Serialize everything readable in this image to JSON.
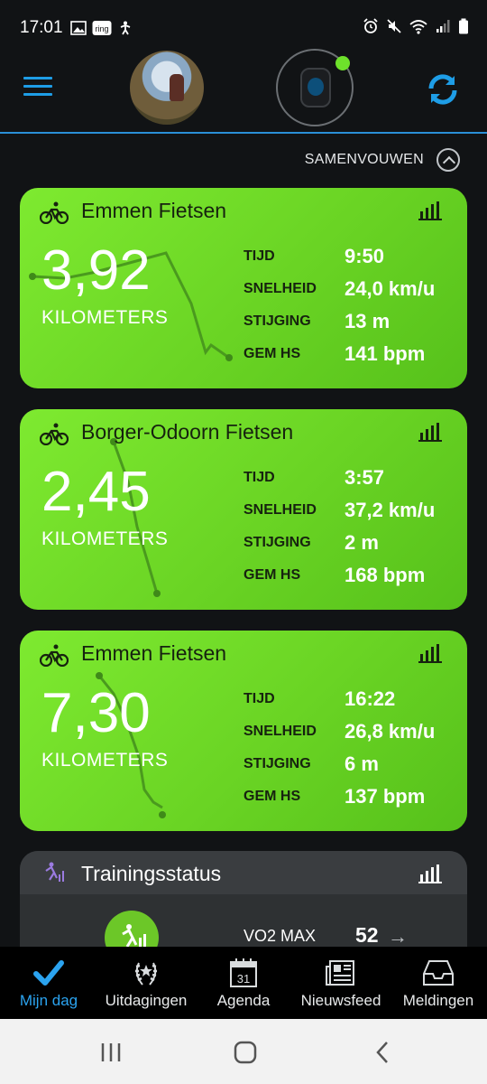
{
  "status_bar": {
    "time": "17:01",
    "left_icons": [
      "image-icon",
      "ring-icon",
      "accessibility-icon"
    ],
    "right_icons": [
      "alarm-icon",
      "mute-icon",
      "wifi-icon",
      "signal-icon",
      "battery-icon"
    ],
    "ring_text": "ring"
  },
  "header": {
    "menu": "menu-icon",
    "sync": "sync-icon",
    "accent": "#1e9de6"
  },
  "collapse": {
    "label": "SAMENVOUWEN"
  },
  "activities": [
    {
      "title": "Emmen Fietsen",
      "distance": "3,92",
      "unit": "KILOMETERS",
      "stats": [
        {
          "k": "TIJD",
          "v": "9:50"
        },
        {
          "k": "SNELHEID",
          "v": "24,0 km/u"
        },
        {
          "k": "STIJGING",
          "v": "13 m"
        },
        {
          "k": "GEM HS",
          "v": "141 bpm"
        }
      ]
    },
    {
      "title": "Borger-Odoorn Fietsen",
      "distance": "2,45",
      "unit": "KILOMETERS",
      "stats": [
        {
          "k": "TIJD",
          "v": "3:57"
        },
        {
          "k": "SNELHEID",
          "v": "37,2 km/u"
        },
        {
          "k": "STIJGING",
          "v": "2 m"
        },
        {
          "k": "GEM HS",
          "v": "168 bpm"
        }
      ]
    },
    {
      "title": "Emmen Fietsen",
      "distance": "7,30",
      "unit": "KILOMETERS",
      "stats": [
        {
          "k": "TIJD",
          "v": "16:22"
        },
        {
          "k": "SNELHEID",
          "v": "26,8 km/u"
        },
        {
          "k": "STIJGING",
          "v": "6 m"
        },
        {
          "k": "GEM HS",
          "v": "137 bpm"
        }
      ]
    }
  ],
  "training": {
    "title": "Trainingsstatus",
    "metric_label": "VO2 MAX",
    "metric_value": "52",
    "arrow": "→"
  },
  "bottom_nav": [
    {
      "label": "Mijn dag",
      "icon": "check-icon",
      "active": true
    },
    {
      "label": "Uitdagingen",
      "icon": "laurel-icon",
      "active": false
    },
    {
      "label": "Agenda",
      "icon": "calendar-icon",
      "active": false,
      "day": "31"
    },
    {
      "label": "Nieuwsfeed",
      "icon": "newspaper-icon",
      "active": false
    },
    {
      "label": "Meldingen",
      "icon": "inbox-icon",
      "active": false
    }
  ],
  "colors": {
    "card_green": "#6ad424",
    "background": "#111315",
    "active_blue": "#2ba3ef"
  }
}
